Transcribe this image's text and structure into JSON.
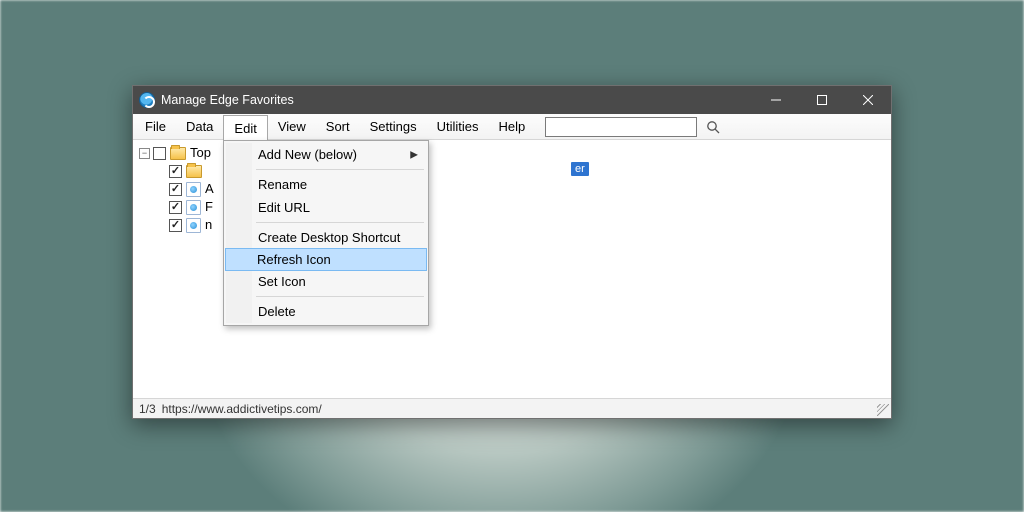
{
  "window": {
    "title": "Manage Edge Favorites"
  },
  "menubar": {
    "items": [
      "File",
      "Data",
      "Edit",
      "View",
      "Sort",
      "Settings",
      "Utilities",
      "Help"
    ],
    "active_index": 2,
    "search_placeholder": ""
  },
  "dropdown": {
    "groups": [
      [
        {
          "label": "Add New (below)",
          "submenu": true
        }
      ],
      [
        {
          "label": "Rename"
        },
        {
          "label": "Edit URL"
        }
      ],
      [
        {
          "label": "Create Desktop Shortcut"
        },
        {
          "label": "Refresh Icon",
          "highlighted": true
        },
        {
          "label": "Set Icon"
        }
      ],
      [
        {
          "label": "Delete"
        }
      ]
    ]
  },
  "tree": {
    "root": {
      "label": "Top",
      "expanded": true,
      "checked": false
    },
    "children": [
      {
        "type": "folder",
        "label": "",
        "checked": true
      },
      {
        "type": "fav",
        "label": "A",
        "checked": true
      },
      {
        "type": "fav",
        "label": "F",
        "checked": true
      },
      {
        "type": "fav",
        "label": "n",
        "checked": true
      }
    ],
    "selection_tag": "er"
  },
  "statusbar": {
    "counter": "1/3",
    "url": "https://www.addictivetips.com/"
  }
}
